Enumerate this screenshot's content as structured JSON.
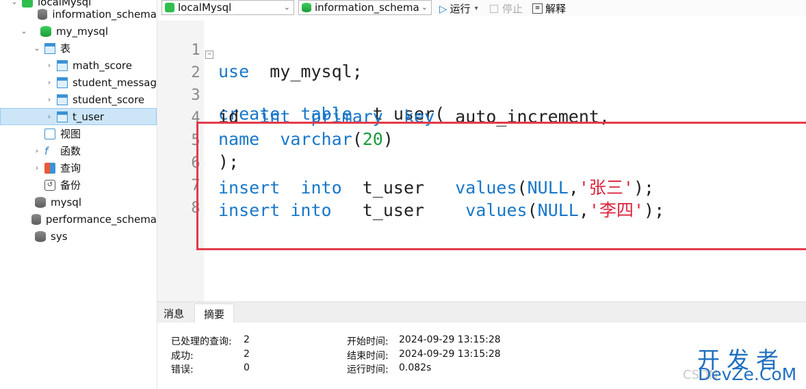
{
  "sidebar": {
    "items": [
      {
        "label": "localMysql",
        "icon": "connection-icon"
      },
      {
        "label": "information_schema",
        "icon": "database-icon"
      },
      {
        "label": "my_mysql",
        "icon": "database-icon"
      },
      {
        "label": "表",
        "icon": "tables-folder-icon"
      },
      {
        "label": "math_score",
        "icon": "table-icon"
      },
      {
        "label": "student_messag",
        "icon": "table-icon"
      },
      {
        "label": "student_score",
        "icon": "table-icon"
      },
      {
        "label": "t_user",
        "icon": "table-icon"
      },
      {
        "label": "视图",
        "icon": "view-icon"
      },
      {
        "label": "函数",
        "icon": "function-icon"
      },
      {
        "label": "查询",
        "icon": "query-icon"
      },
      {
        "label": "备份",
        "icon": "backup-icon"
      },
      {
        "label": "mysql",
        "icon": "database-icon"
      },
      {
        "label": "performance_schema",
        "icon": "database-icon"
      },
      {
        "label": "sys",
        "icon": "database-icon"
      }
    ],
    "selected": "t_user"
  },
  "toolbar": {
    "connection": "localMysql",
    "database": "information_schema",
    "run_label": "运行",
    "stop_label": "停止",
    "explain_label": "解释"
  },
  "editor": {
    "line_numbers": [
      "1",
      "2",
      "3",
      "4",
      "5",
      "6",
      "7",
      "8"
    ],
    "lines": {
      "l1_kw": "use",
      "l1_rest": "  my_mysql;",
      "l2_kw1": "create",
      "l2_kw2": "table",
      "l2_rest": "  t_user(",
      "l3_a": "id  ",
      "l3_kw1": "int",
      "l3_kw2": "primary",
      "l3_kw3": "key",
      "l3_rest": "  auto_increment,",
      "l4_kw1": "name",
      "l4_kw2": "varchar",
      "l4_open": "(",
      "l4_num": "20",
      "l4_close": ")",
      "l5": ");",
      "l6_kw1": "insert",
      "l6_kw2": "into",
      "l6_mid": "  t_user   ",
      "l6_kw3": "values",
      "l6_open": "(",
      "l6_null": "NULL",
      "l6_comma": ",",
      "l6_str": "'张三'",
      "l6_end": ");",
      "l7_kw1": "insert",
      "l7_kw2": "into",
      "l7_mid": "   t_user    ",
      "l7_kw3": "values",
      "l7_open": "(",
      "l7_null": "NULL",
      "l7_comma": ",",
      "l7_str": "'李四'",
      "l7_end": ");"
    }
  },
  "bottom": {
    "tabs": [
      "消息",
      "摘要"
    ],
    "active_tab": "摘要",
    "summary": {
      "processed_label": "已处理的查询:",
      "processed_value": "2",
      "success_label": "成功:",
      "success_value": "2",
      "error_label": "错误:",
      "error_value": "0",
      "start_label": "开始时间:",
      "start_value": "2024-09-29 13:15:28",
      "end_label": "结束时间:",
      "end_value": "2024-09-29 13:15:28",
      "runtime_label": "运行时间:",
      "runtime_value": "0.082s"
    }
  },
  "watermark": {
    "cn": "开发者",
    "en": "DevZe.CoM",
    "csdn": "CSDN"
  },
  "colors": {
    "keyword": "#1877c9",
    "string": "#d9243c",
    "number": "#1a9b3b",
    "highlight_box": "#e33a48",
    "selection": "#cce6f8"
  }
}
